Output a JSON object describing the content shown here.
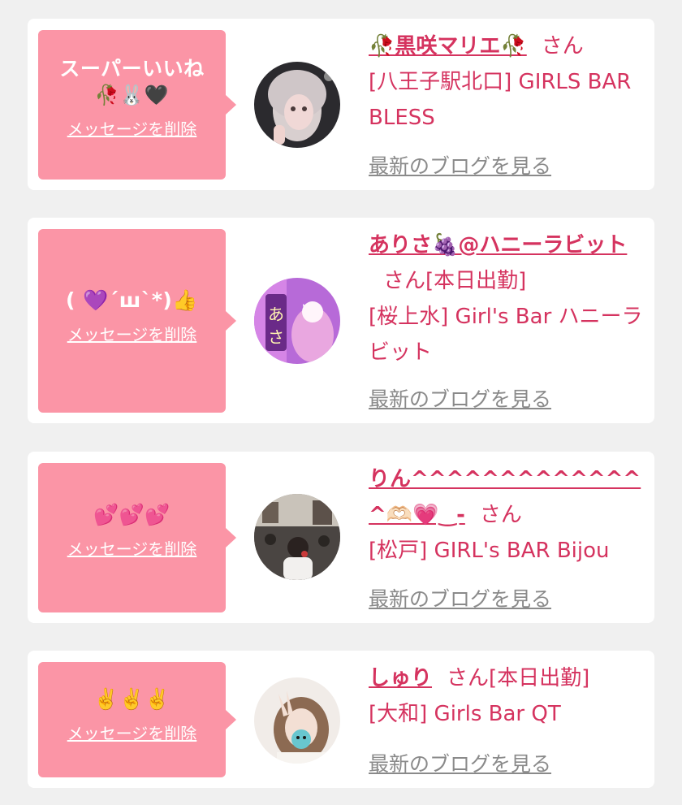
{
  "cards": [
    {
      "message_line1": "スーパーいいね",
      "message_line2": "🥀🐰🖤",
      "delete_label": "メッセージを削除",
      "name": "🥀黒咲マリエ🥀",
      "honorific": "さん",
      "status": "",
      "shop": "[八王子駅北口] GIRLS BAR BLESS",
      "blog_label": "最新のブログを見る"
    },
    {
      "message_line1": "( 💜´ш`*)👍",
      "message_line2": "",
      "delete_label": "メッセージを削除",
      "name": "ありさ🍇@ハニーラビット",
      "honorific": "さん",
      "status": "[本日出勤]",
      "shop": "[桜上水] Girl's Bar ハニーラビット",
      "blog_label": "最新のブログを見る"
    },
    {
      "message_line1": "💕💕💕",
      "message_line2": "",
      "delete_label": "メッセージを削除",
      "name": "りん^^^^^^^^^^^^^^🫶🏻💗‿-",
      "honorific": "さん",
      "status": "",
      "shop": "[松戸] GIRL's BAR Bijou",
      "blog_label": "最新のブログを見る"
    },
    {
      "message_line1": "✌️✌️✌️",
      "message_line2": "",
      "delete_label": "メッセージを削除",
      "name": "しゅり",
      "honorific": "さん",
      "status": "[本日出勤]",
      "shop": "[大和] Girls Bar QT",
      "blog_label": "最新のブログを見る"
    }
  ],
  "colors": {
    "background": "#f0f0f0",
    "card": "#ffffff",
    "bubble": "#fb95a6",
    "accent_text": "#d5335f",
    "blog_link": "#8a8a8a"
  }
}
